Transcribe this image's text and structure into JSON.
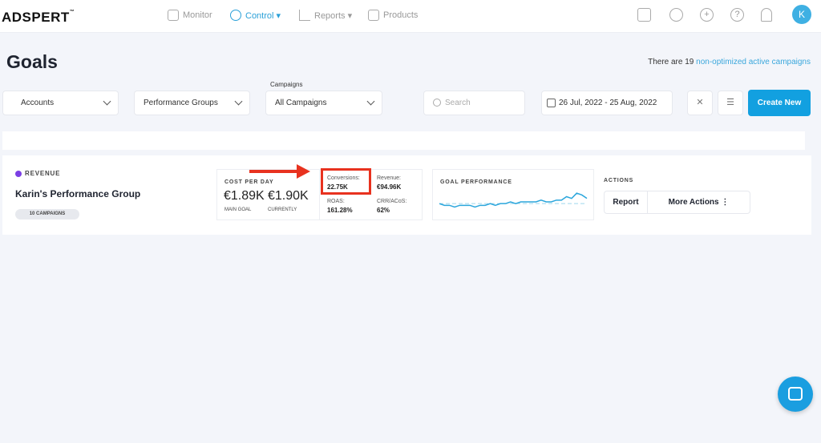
{
  "brand": {
    "logo": "ADSPERT",
    "tm": "™"
  },
  "nav": [
    {
      "label": "Monitor",
      "icon": "dashboard-icon"
    },
    {
      "label": "Control ▾",
      "icon": "control-icon",
      "active": true
    },
    {
      "label": "Reports ▾",
      "icon": "chart-icon"
    },
    {
      "label": "Products",
      "icon": "box-icon"
    }
  ],
  "avatar": "K",
  "page": {
    "title": "Goals",
    "notice_prefix": "There are 19 ",
    "notice_link": "non-optimized active campaigns"
  },
  "filters": {
    "accounts": "Accounts",
    "performance_groups": "Performance Groups",
    "campaigns_label": "Campaigns",
    "campaigns": "All Campaigns",
    "search_placeholder": "Search",
    "date_range": "26 Jul, 2022 - 25 Aug, 2022",
    "create": "Create New"
  },
  "goal": {
    "type": "REVENUE",
    "type_color": "#7b3fe4",
    "name": "Karin's Performance Group",
    "campaigns": "10 CAMPAIGNS",
    "cost_title": "COST PER DAY",
    "main_goal": "€1.89K",
    "main_goal_label": "MAIN GOAL",
    "currently": "€1.90K",
    "currently_label": "CURRENTLY",
    "metrics": {
      "conversions_label": "Conversions:",
      "conversions": "22.75K",
      "revenue_label": "Revenue:",
      "revenue": "€94.96K",
      "roas_label": "ROAS:",
      "roas": "161.28%",
      "crr_label": "CRR/ACoS:",
      "crr": "62%"
    },
    "performance_title": "GOAL PERFORMANCE",
    "trend": [
      5,
      4,
      4,
      3,
      4,
      4,
      4,
      3,
      4,
      4,
      5,
      4,
      5,
      5,
      6,
      5,
      6,
      6,
      6,
      6,
      7,
      6,
      6,
      7,
      7,
      9,
      8,
      11,
      10,
      8
    ],
    "target": 5,
    "actions_title": "ACTIONS",
    "report": "Report",
    "more": "More Actions ⋮"
  },
  "colors": {
    "accent": "#12a0e0",
    "highlight": "#e8321f"
  }
}
